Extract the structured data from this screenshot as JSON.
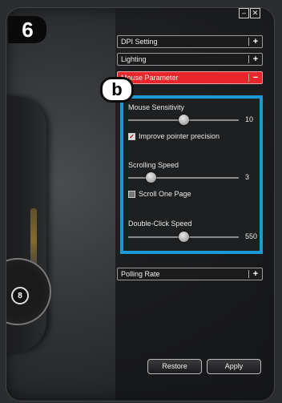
{
  "app": {
    "step_number": "6",
    "callout_letter": "b",
    "dial_badge": "8"
  },
  "window": {
    "minimize_glyph": "–",
    "close_glyph": "✕"
  },
  "sections": {
    "dpi": {
      "label": "DPI Setting",
      "toggle": "+"
    },
    "lighting": {
      "label": "Lighting",
      "toggle": "+"
    },
    "mouse_parameter": {
      "label": "Mouse Parameter",
      "toggle": "−"
    },
    "polling": {
      "label": "Polling Rate",
      "toggle": "+"
    }
  },
  "params": {
    "sensitivity": {
      "label": "Mouse Sensitivity",
      "value": "10",
      "level": 0.5
    },
    "precision": {
      "label": "Improve pointer precision",
      "checked": true,
      "mark": "✓"
    },
    "scrolling": {
      "label": "Scrolling Speed",
      "value": "3",
      "level": 0.2
    },
    "scroll_page": {
      "label": "Scroll One Page",
      "checked": false
    },
    "double_click": {
      "label": "Double-Click Speed",
      "value": "550",
      "level": 0.5
    }
  },
  "buttons": {
    "restore": "Restore",
    "apply": "Apply"
  },
  "colors": {
    "accent_red": "#e8262b",
    "highlight_blue": "#1b9ad6"
  }
}
